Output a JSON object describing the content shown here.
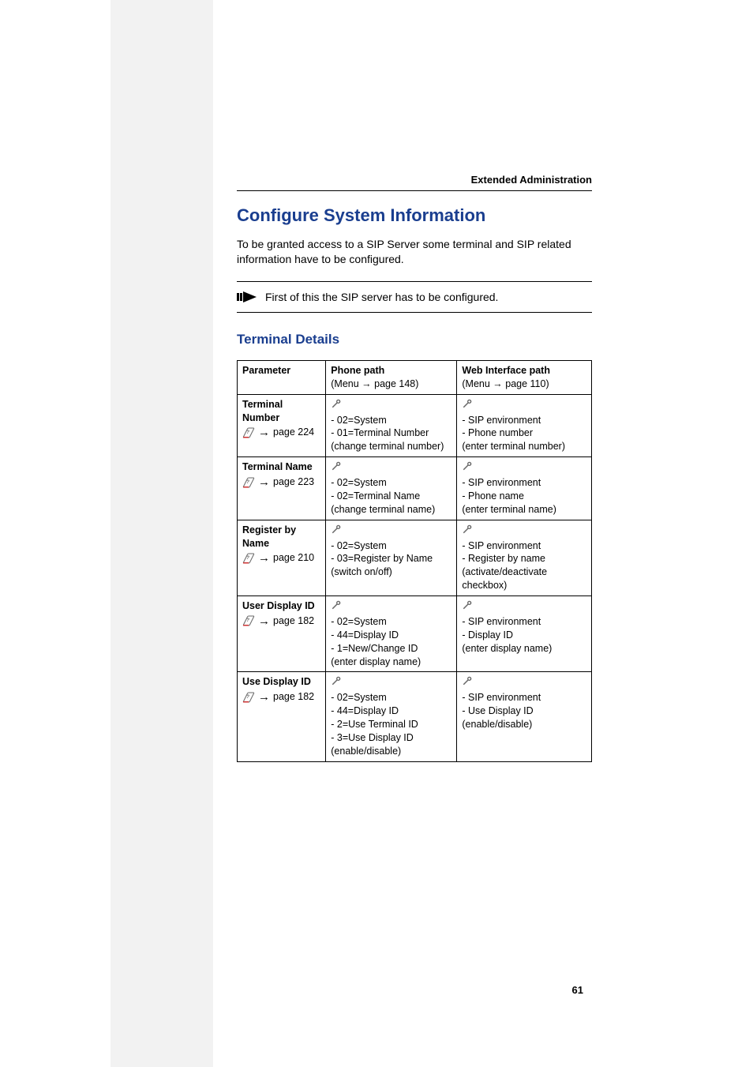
{
  "header": {
    "section_label": "Extended Administration",
    "page_number": "61"
  },
  "h1": "Configure System Information",
  "intro": "To be granted access to a SIP Server some terminal and SIP related information have to be configured.",
  "note": {
    "text": "First of this the SIP server has to be configured."
  },
  "h2": "Terminal Details",
  "table": {
    "header": {
      "parameter": "Parameter",
      "phone_path": "Phone path",
      "phone_sub": "(Menu → page 148)",
      "web_path": "Web Interface path",
      "web_sub": "(Menu → page 110)"
    },
    "rows": [
      {
        "name": "Terminal Number",
        "page_ref": "page 224",
        "phone": "- 02=System\n- 01=Terminal Number\n(change terminal number)",
        "web": "- SIP environment\n- Phone number\n(enter terminal number)"
      },
      {
        "name": "Terminal Name",
        "page_ref": "page 223",
        "phone": "- 02=System\n- 02=Terminal Name\n(change terminal name)",
        "web": "- SIP environment\n- Phone name\n(enter terminal name)"
      },
      {
        "name": "Register by Name",
        "page_ref": "page 210",
        "phone": "- 02=System\n- 03=Register by Name\n(switch on/off)",
        "web": "- SIP environment\n- Register by name\n(activate/deactivate checkbox)"
      },
      {
        "name": "User Display ID",
        "page_ref": "page 182",
        "phone": "- 02=System\n- 44=Display ID\n-  1=New/Change ID\n(enter display name)",
        "web": "- SIP environment\n- Display ID\n(enter display name)"
      },
      {
        "name": "Use Display ID",
        "page_ref": "page 182",
        "phone": "- 02=System\n- 44=Display ID\n-  2=Use Terminal ID\n- 3=Use Display ID\n(enable/disable)",
        "web": "- SIP environment\n- Use Display ID\n(enable/disable)"
      }
    ]
  }
}
